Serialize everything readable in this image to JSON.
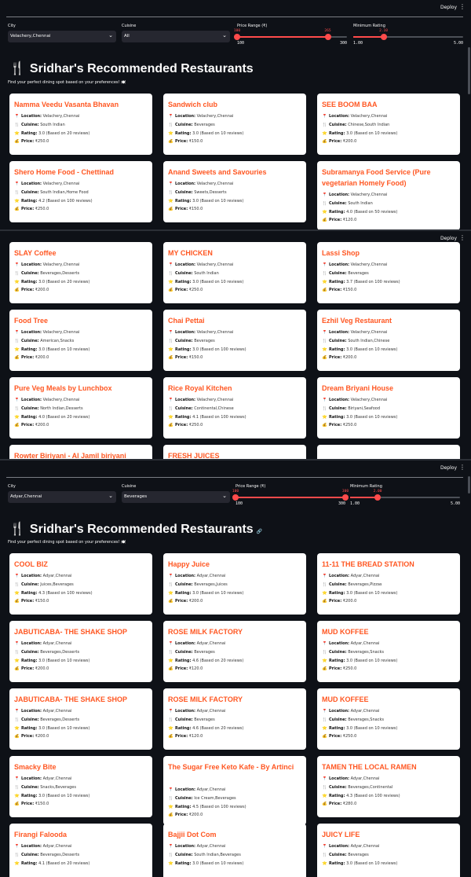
{
  "app": {
    "deploy_label": "Deploy",
    "menu_glyph": "⋮",
    "title": "Sridhar's Recommended Restaurants",
    "title_icon": "🍴",
    "subtitle": "Find your perfect dining spot based on your preferences! 🍽️",
    "anchor_glyph": "🔗"
  },
  "labels": {
    "location": "Location:",
    "cuisine": "Cuisine:",
    "rating": "Rating:",
    "price": "Price:",
    "icon_location": "📍",
    "icon_cuisine": "🍴",
    "icon_rating": "⭐",
    "icon_price": "💰"
  },
  "colors": {
    "accent": "#ff4b4b",
    "restaurant_name": "#ff5722",
    "background": "#0e1117",
    "input_bg": "#262730"
  },
  "filters_1": {
    "city_label": "City",
    "city_value": "Velachery,Chennai",
    "cuisine_label": "Cuisine",
    "cuisine_value": "All",
    "price_label": "Price Range (₹)",
    "price_low": "100",
    "price_high": "265",
    "price_min_tick": "100",
    "price_max_tick": "300",
    "price_low_frac": 0.0,
    "price_high_frac": 0.825,
    "rating_label": "Minimum Rating",
    "rating_value": "2.10",
    "rating_min_tick": "1.00",
    "rating_max_tick": "5.00",
    "rating_frac": 0.275
  },
  "filters_3": {
    "city_label": "City",
    "city_value": "Adyar,Chennai",
    "cuisine_label": "Cuisine",
    "cuisine_value": "Beverages",
    "price_label": "Price Range (₹)",
    "price_low": "100",
    "price_high": "300",
    "price_min_tick": "100",
    "price_max_tick": "300",
    "price_low_frac": 0.0,
    "price_high_frac": 1.0,
    "rating_label": "Minimum Rating",
    "rating_value": "2.00",
    "rating_min_tick": "1.00",
    "rating_max_tick": "5.00",
    "rating_frac": 0.25
  },
  "cards_1": [
    {
      "name": "Namma Veedu Vasanta Bhavan",
      "location": "Velachery,Chennai",
      "cuisine": "South Indian",
      "rating": "3.0 (Based on 20 reviews)",
      "price": "₹250.0"
    },
    {
      "name": "Sandwich club",
      "location": "Velachery,Chennai",
      "cuisine": "Beverages",
      "rating": "3.0 (Based on 10 reviews)",
      "price": "₹150.0"
    },
    {
      "name": "SEE BOOM BAA",
      "location": "Velachery,Chennai",
      "cuisine": "Chinese,South Indian",
      "rating": "3.0 (Based on 10 reviews)",
      "price": "₹200.0"
    },
    {
      "name": "Shero Home Food - Chettinad",
      "location": "Velachery,Chennai",
      "cuisine": "South Indian,Home Food",
      "rating": "4.2 (Based on 100 reviews)",
      "price": "₹250.0"
    },
    {
      "name": "Anand Sweets and Savouries",
      "location": "Velachery,Chennai",
      "cuisine": "Sweets,Desserts",
      "rating": "3.0 (Based on 10 reviews)",
      "price": "₹150.0"
    },
    {
      "name": "Subramanya Food Service (Pure vegetarian Homely Food)",
      "location": "Velachery,Chennai",
      "cuisine": "South Indian",
      "rating": "4.0 (Based on 50 reviews)",
      "price": "₹120.0"
    }
  ],
  "cards_2": [
    {
      "name": "SLAY Coffee",
      "location": "Velachery,Chennai",
      "cuisine": "Beverages,Desserts",
      "rating": "3.0 (Based on 20 reviews)",
      "price": "₹200.0"
    },
    {
      "name": "MY CHICKEN",
      "location": "Velachery,Chennai",
      "cuisine": "South Indian",
      "rating": "3.0 (Based on 10 reviews)",
      "price": "₹250.0"
    },
    {
      "name": "Lassi Shop",
      "location": "Velachery,Chennai",
      "cuisine": "Beverages",
      "rating": "3.7 (Based on 100 reviews)",
      "price": "₹150.0"
    },
    {
      "name": "Food Tree",
      "location": "Velachery,Chennai",
      "cuisine": "American,Snacks",
      "rating": "3.0 (Based on 10 reviews)",
      "price": "₹200.0"
    },
    {
      "name": "Chai Pettai",
      "location": "Velachery,Chennai",
      "cuisine": "Beverages",
      "rating": "3.0 (Based on 100 reviews)",
      "price": "₹150.0"
    },
    {
      "name": "Ezhil Veg Restaurant",
      "location": "Velachery,Chennai",
      "cuisine": "South Indian,Chinese",
      "rating": "3.0 (Based on 10 reviews)",
      "price": "₹200.0"
    },
    {
      "name": "Pure Veg Meals by Lunchbox",
      "location": "Velachery,Chennai",
      "cuisine": "North Indian,Desserts",
      "rating": "4.0 (Based on 20 reviews)",
      "price": "₹200.0"
    },
    {
      "name": "Rice Royal Kitchen",
      "location": "Velachery,Chennai",
      "cuisine": "Continental,Chinese",
      "rating": "4.1 (Based on 100 reviews)",
      "price": "₹250.0"
    },
    {
      "name": "Dream Briyani House",
      "location": "Velachery,Chennai",
      "cuisine": "Biriyani,Seafood",
      "rating": "3.0 (Based on 10 reviews)",
      "price": "₹250.0"
    },
    {
      "name": "Rowter Biriyani - Al Jamil biriyani",
      "location": "",
      "cuisine": "",
      "rating": "",
      "price": ""
    },
    {
      "name": "FRESH JUICES",
      "location": "",
      "cuisine": "",
      "rating": "",
      "price": ""
    },
    {
      "name": "",
      "location": "",
      "cuisine": "",
      "rating": "",
      "price": ""
    }
  ],
  "cards_3": [
    {
      "name": "COOL BIZ",
      "location": "Adyar,Chennai",
      "cuisine": "Juices,Beverages",
      "rating": "4.3 (Based on 100 reviews)",
      "price": "₹150.0"
    },
    {
      "name": "Happy Juice",
      "location": "Adyar,Chennai",
      "cuisine": "Beverages,Juices",
      "rating": "3.0 (Based on 10 reviews)",
      "price": "₹200.0"
    },
    {
      "name": "11-11 THE BREAD STATION",
      "location": "Adyar,Chennai",
      "cuisine": "Beverages,Pizzas",
      "rating": "3.0 (Based on 10 reviews)",
      "price": "₹200.0"
    },
    {
      "name": "JABUTICABA- THE SHAKE SHOP",
      "location": "Adyar,Chennai",
      "cuisine": "Beverages,Desserts",
      "rating": "3.0 (Based on 10 reviews)",
      "price": "₹200.0"
    },
    {
      "name": "ROSE MILK FACTORY",
      "location": "Adyar,Chennai",
      "cuisine": "Beverages",
      "rating": "4.6 (Based on 20 reviews)",
      "price": "₹120.0"
    },
    {
      "name": "MUD KOFFEE",
      "location": "Adyar,Chennai",
      "cuisine": "Beverages,Snacks",
      "rating": "3.0 (Based on 10 reviews)",
      "price": "₹250.0"
    },
    {
      "name": "JABUTICABA- THE SHAKE SHOP",
      "location": "Adyar,Chennai",
      "cuisine": "Beverages,Desserts",
      "rating": "3.0 (Based on 10 reviews)",
      "price": "₹200.0"
    },
    {
      "name": "ROSE MILK FACTORY",
      "location": "Adyar,Chennai",
      "cuisine": "Beverages",
      "rating": "4.6 (Based on 20 reviews)",
      "price": "₹120.0"
    },
    {
      "name": "MUD KOFFEE",
      "location": "Adyar,Chennai",
      "cuisine": "Beverages,Snacks",
      "rating": "3.0 (Based on 10 reviews)",
      "price": "₹250.0"
    },
    {
      "name": "Smacky Bite",
      "location": "Adyar,Chennai",
      "cuisine": "Snacks,Beverages",
      "rating": "3.0 (Based on 10 reviews)",
      "price": "₹150.0"
    },
    {
      "name": "The Sugar Free Keto Kafe - By Artinci",
      "location": "Adyar,Chennai",
      "cuisine": "Ice Cream,Beverages",
      "rating": "4.5 (Based on 100 reviews)",
      "price": "₹200.0"
    },
    {
      "name": "TAMEN THE LOCAL RAMEN",
      "location": "Adyar,Chennai",
      "cuisine": "Beverages,Continental",
      "rating": "4.3 (Based on 100 reviews)",
      "price": "₹280.0"
    },
    {
      "name": "Firangi Falooda",
      "location": "Adyar,Chennai",
      "cuisine": "Beverages,Desserts",
      "rating": "4.1 (Based on 20 reviews)",
      "price": ""
    },
    {
      "name": "Bajjii Dot Com",
      "location": "Adyar,Chennai",
      "cuisine": "South Indian,Beverages",
      "rating": "3.0 (Based on 10 reviews)",
      "price": ""
    },
    {
      "name": "JUICY LIFE",
      "location": "Adyar,Chennai",
      "cuisine": "Beverages",
      "rating": "3.0 (Based on 10 reviews)",
      "price": ""
    }
  ]
}
